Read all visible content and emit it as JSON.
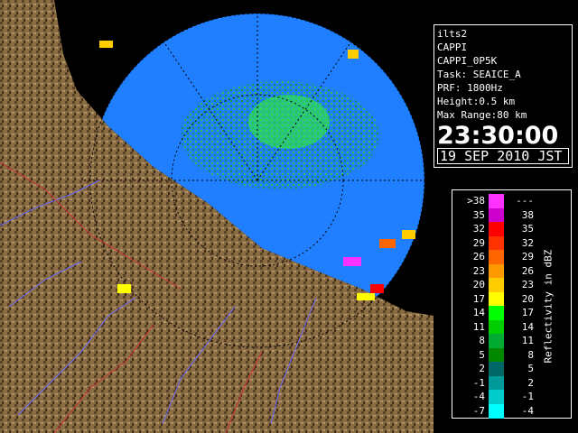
{
  "info": {
    "station": "ilts2",
    "product": "CAPPI",
    "product_id": "CAPPI_0P5K",
    "task": "Task: SEAICE_A",
    "prf": "PRF: 1800Hz",
    "height": "Height:0.5 km",
    "max_range": "Max Range:80 km",
    "time": "23:30:00",
    "date": "19 SEP 2010 JST"
  },
  "legend": {
    "title": "Reflectivity in dBZ",
    "rows": [
      {
        "lo": ">38",
        "hi": "---",
        "color": "#ff33ff"
      },
      {
        "lo": "35",
        "hi": "38",
        "color": "#cc00cc"
      },
      {
        "lo": "32",
        "hi": "35",
        "color": "#ff0000"
      },
      {
        "lo": "29",
        "hi": "32",
        "color": "#ff3300"
      },
      {
        "lo": "26",
        "hi": "29",
        "color": "#ff6600"
      },
      {
        "lo": "23",
        "hi": "26",
        "color": "#ff9900"
      },
      {
        "lo": "20",
        "hi": "23",
        "color": "#ffcc00"
      },
      {
        "lo": "17",
        "hi": "20",
        "color": "#ffff00"
      },
      {
        "lo": "14",
        "hi": "17",
        "color": "#00ff00"
      },
      {
        "lo": "11",
        "hi": "14",
        "color": "#00cc00"
      },
      {
        "lo": "8",
        "hi": "11",
        "color": "#00aa33"
      },
      {
        "lo": "5",
        "hi": "8",
        "color": "#008800"
      },
      {
        "lo": "2",
        "hi": "5",
        "color": "#006666"
      },
      {
        "lo": "-1",
        "hi": "2",
        "color": "#009999"
      },
      {
        "lo": "-4",
        "hi": "-1",
        "color": "#00cccc"
      },
      {
        "lo": "-7",
        "hi": "-4",
        "color": "#00ffff"
      }
    ]
  }
}
